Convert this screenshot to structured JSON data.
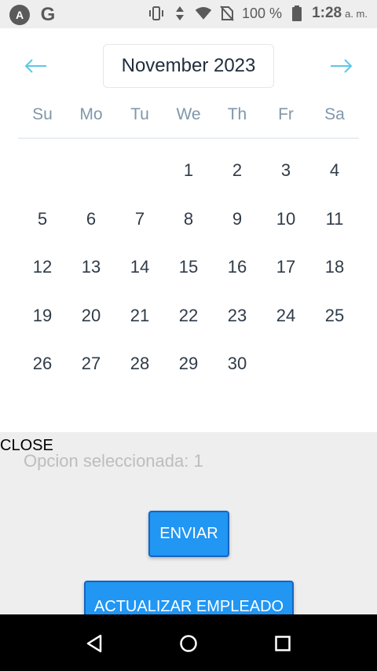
{
  "status_bar": {
    "battery": "100 %",
    "time": "1:28",
    "ampm": "a. m."
  },
  "calendar": {
    "month_label": "November 2023",
    "weekdays": [
      "Su",
      "Mo",
      "Tu",
      "We",
      "Th",
      "Fr",
      "Sa"
    ],
    "days": [
      "",
      "",
      "",
      "1",
      "2",
      "3",
      "4",
      "5",
      "6",
      "7",
      "8",
      "9",
      "10",
      "11",
      "12",
      "13",
      "14",
      "15",
      "16",
      "17",
      "18",
      "19",
      "20",
      "21",
      "22",
      "23",
      "24",
      "25",
      "26",
      "27",
      "28",
      "29",
      "30",
      "",
      ""
    ]
  },
  "form": {
    "close_label": "CLOSE",
    "selected_text": "Opcion seleccionada: 1",
    "submit_label": "ENVIAR",
    "update_label": "ACTUALIZAR EMPLEADO"
  },
  "colors": {
    "accent": "#2196f3",
    "arrow": "#5bc8e8"
  }
}
